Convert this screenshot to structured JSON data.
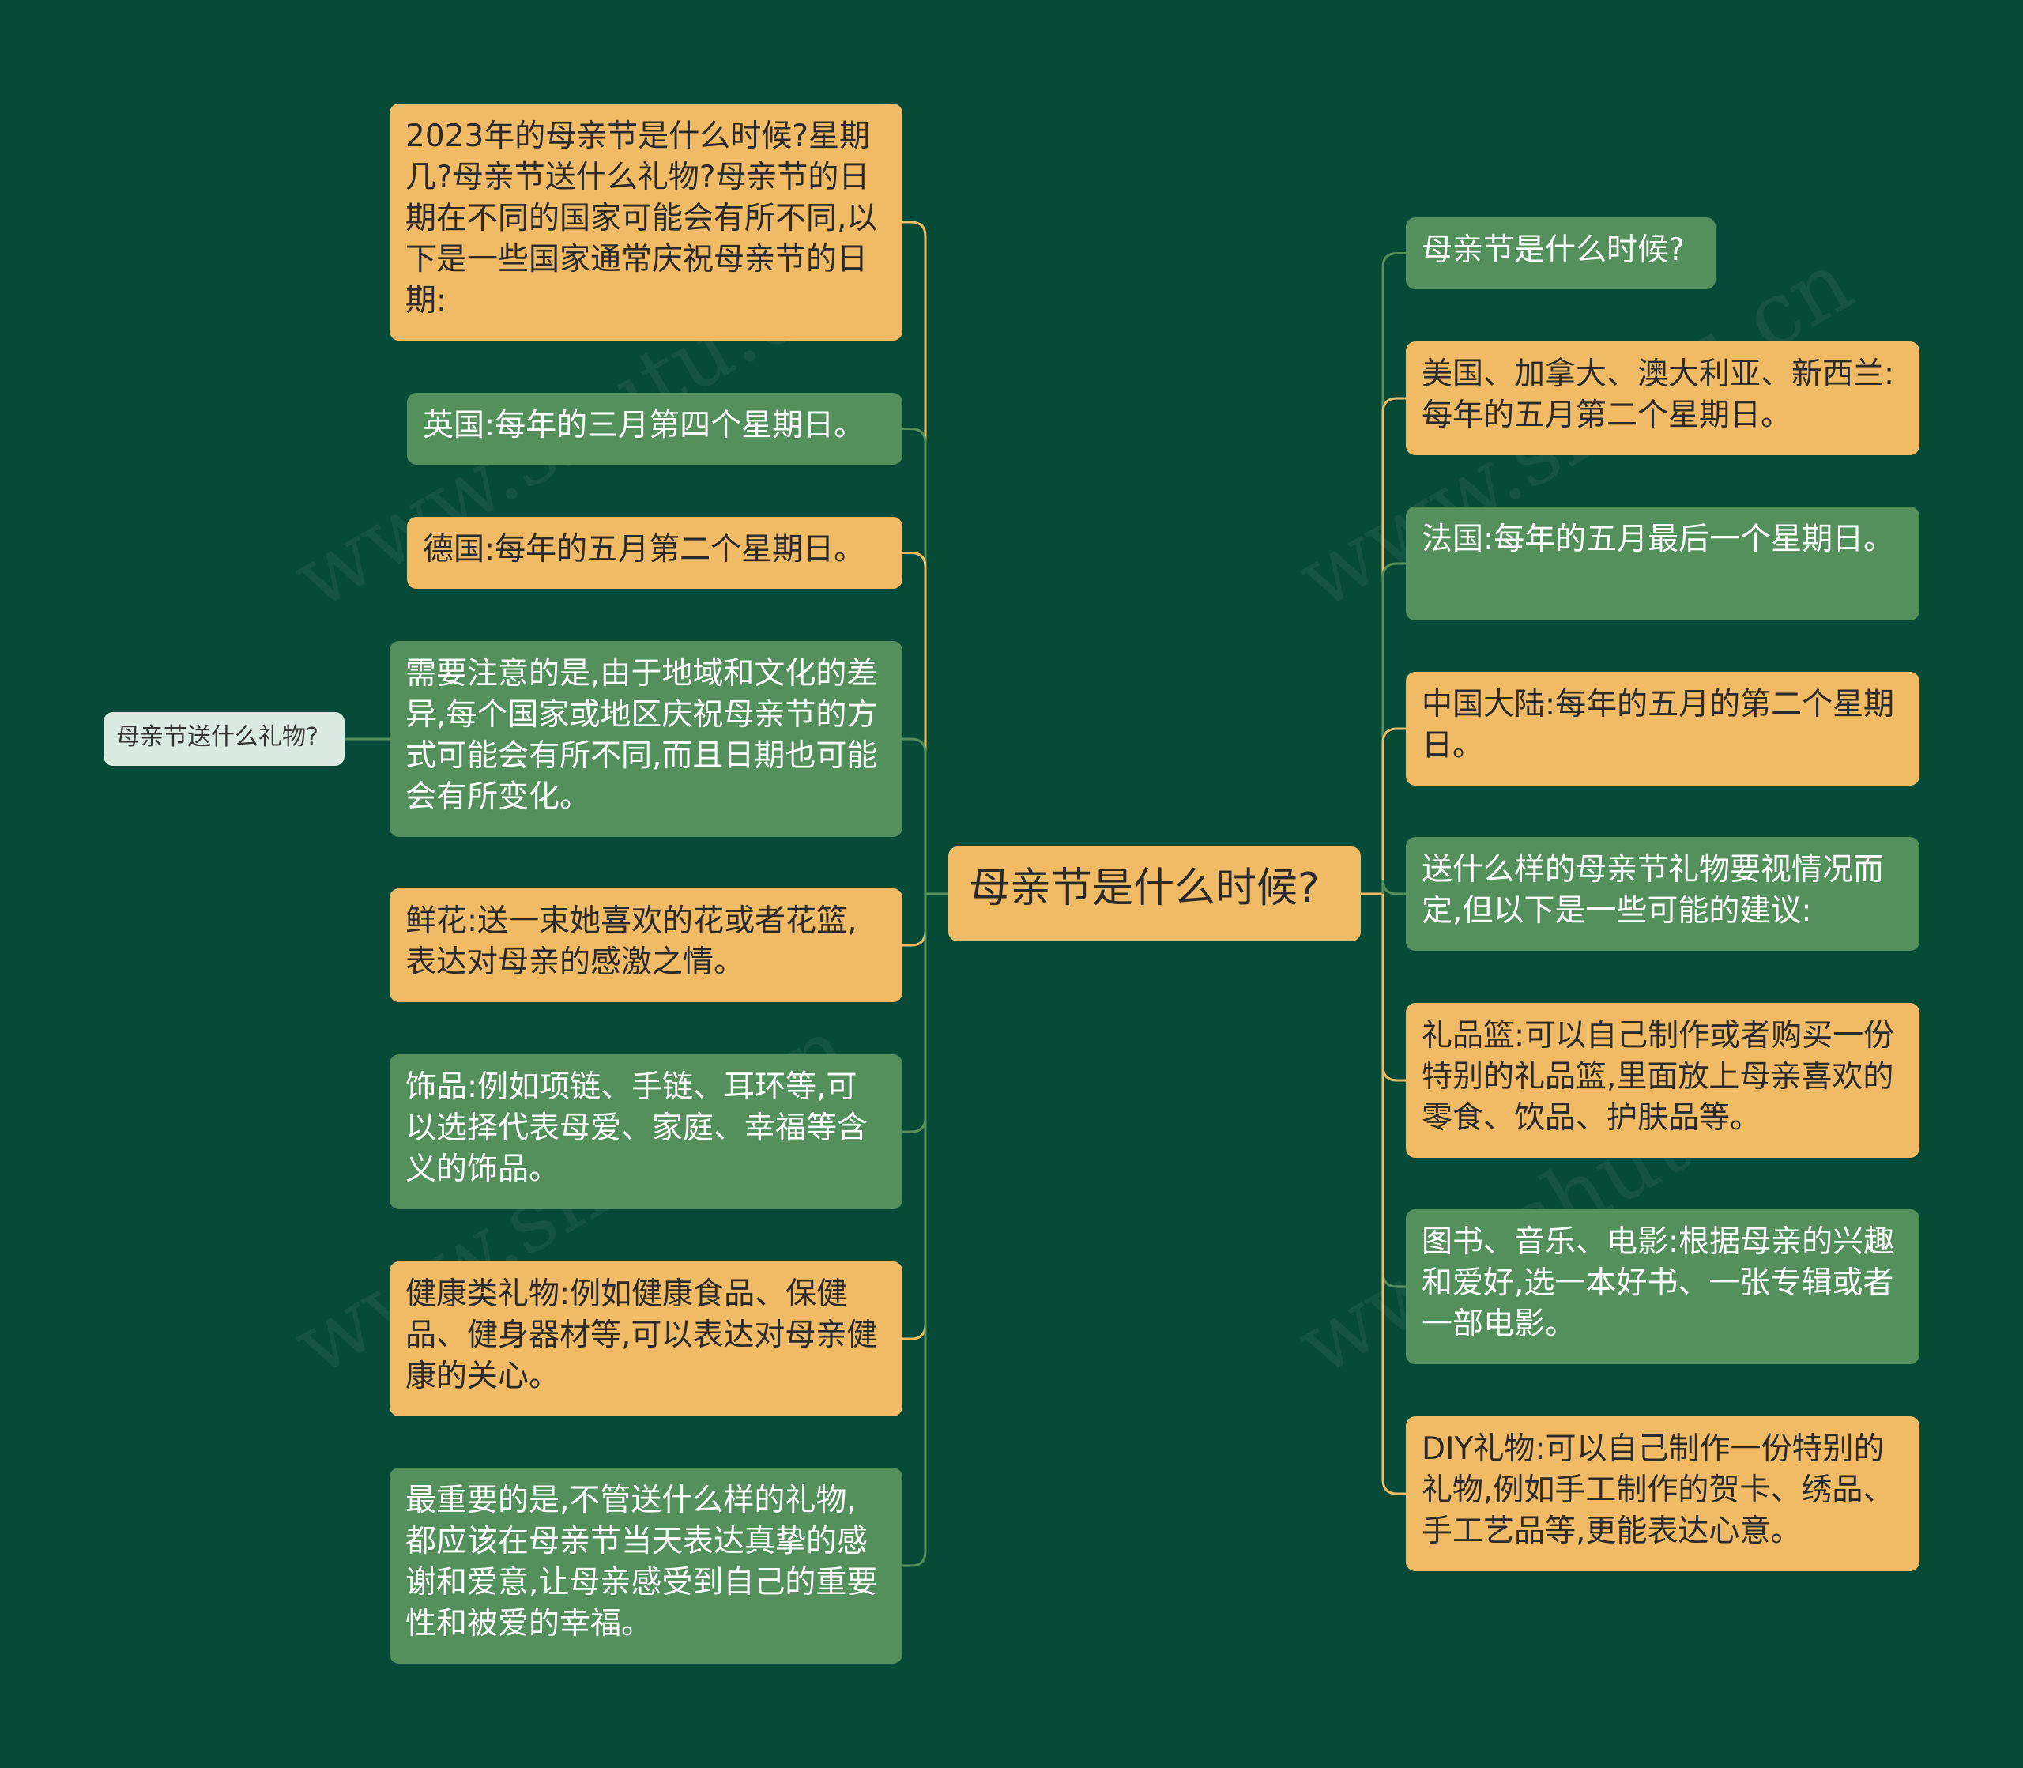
{
  "colors": {
    "background": "#074a37",
    "node_orange": "#f0bb64",
    "node_green": "#53905c",
    "node_light": "#dcebe2",
    "connector_orange": "#f0bb64",
    "connector_green": "#53905c"
  },
  "center": {
    "text": "母亲节是什么时候?"
  },
  "side_topic": {
    "text": "母亲节送什么礼物?"
  },
  "left_nodes": [
    {
      "text": "2023年的母亲节是什么时候?星期几?母亲节送什么礼物?母亲节的日期在不同的国家可能会有所不同,以下是一些国家通常庆祝母亲节的日期:",
      "style": "orange"
    },
    {
      "text": "英国:每年的三月第四个星期日。",
      "style": "green"
    },
    {
      "text": "德国:每年的五月第二个星期日。",
      "style": "orange"
    },
    {
      "text": "需要注意的是,由于地域和文化的差异,每个国家或地区庆祝母亲节的方式可能会有所不同,而且日期也可能会有所变化。",
      "style": "green"
    },
    {
      "text": "鲜花:送一束她喜欢的花或者花篮,表达对母亲的感激之情。",
      "style": "orange"
    },
    {
      "text": "饰品:例如项链、手链、耳环等,可以选择代表母爱、家庭、幸福等含义的饰品。",
      "style": "green"
    },
    {
      "text": "健康类礼物:例如健康食品、保健品、健身器材等,可以表达对母亲健康的关心。",
      "style": "orange"
    },
    {
      "text": "最重要的是,不管送什么样的礼物,都应该在母亲节当天表达真挚的感谢和爱意,让母亲感受到自己的重要性和被爱的幸福。",
      "style": "green"
    }
  ],
  "right_nodes": [
    {
      "text": "母亲节是什么时候?",
      "style": "green"
    },
    {
      "text": "美国、加拿大、澳大利亚、新西兰:每年的五月第二个星期日。",
      "style": "orange"
    },
    {
      "text": "法国:每年的五月最后一个星期日。",
      "style": "green"
    },
    {
      "text": "中国大陆:每年的五月的第二个星期日。",
      "style": "orange"
    },
    {
      "text": "送什么样的母亲节礼物要视情况而定,但以下是一些可能的建议:",
      "style": "green"
    },
    {
      "text": "礼品篮:可以自己制作或者购买一份特别的礼品篮,里面放上母亲喜欢的零食、饮品、护肤品等。",
      "style": "orange"
    },
    {
      "text": "图书、音乐、电影:根据母亲的兴趣和爱好,选一本好书、一张专辑或者一部电影。",
      "style": "green"
    },
    {
      "text": "DIY礼物:可以自己制作一份特别的礼物,例如手工制作的贺卡、绣品、手工艺品等,更能表达心意。",
      "style": "orange"
    }
  ]
}
